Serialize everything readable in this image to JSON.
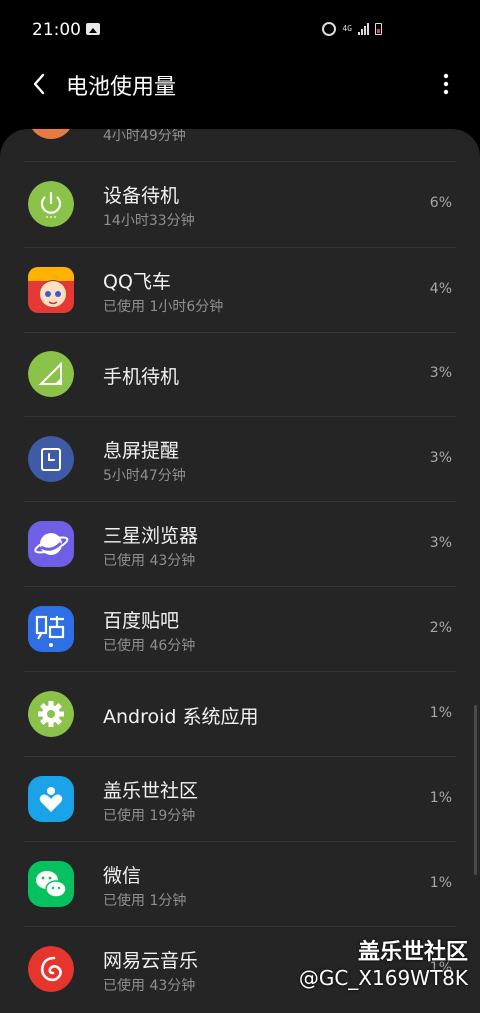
{
  "status_bar": {
    "time": "21:00",
    "network": "4G"
  },
  "header": {
    "title": "电池使用量"
  },
  "partial_item": {
    "sub": "4小时49分钟"
  },
  "items": [
    {
      "title": "设备待机",
      "sub": "14小时33分钟",
      "pct": "6%",
      "icon": "power-icon",
      "color": "#8bc34a"
    },
    {
      "title": "QQ飞车",
      "sub": "已使用 1小时6分钟",
      "pct": "4%",
      "icon": "qq-speed-app-icon",
      "color": "#e53935"
    },
    {
      "title": "手机待机",
      "sub": "",
      "pct": "3%",
      "icon": "cell-signal-icon",
      "color": "#8bc34a"
    },
    {
      "title": "息屏提醒",
      "sub": "5小时47分钟",
      "pct": "3%",
      "icon": "always-on-display-icon",
      "color": "#3f5ba8"
    },
    {
      "title": "三星浏览器",
      "sub": "已使用 43分钟",
      "pct": "3%",
      "icon": "samsung-internet-icon",
      "color": "#6f5fe6"
    },
    {
      "title": "百度贴吧",
      "sub": "已使用 46分钟",
      "pct": "2%",
      "icon": "baidu-tieba-icon",
      "color": "#2f6fe6"
    },
    {
      "title": "Android 系统应用",
      "sub": "",
      "pct": "1%",
      "icon": "android-system-gear-icon",
      "color": "#8bc34a"
    },
    {
      "title": "盖乐世社区",
      "sub": "已使用 19分钟",
      "pct": "1%",
      "icon": "galaxy-community-icon",
      "color": "#1aa3e8"
    },
    {
      "title": "微信",
      "sub": "已使用 1分钟",
      "pct": "1%",
      "icon": "wechat-icon",
      "color": "#07c160"
    },
    {
      "title": "网易云音乐",
      "sub": "已使用 43分钟",
      "pct": "1%",
      "icon": "netease-music-icon",
      "color": "#e5352c"
    }
  ],
  "watermark": {
    "title": "盖乐世社区",
    "user": "@GC_X169WT8K"
  }
}
